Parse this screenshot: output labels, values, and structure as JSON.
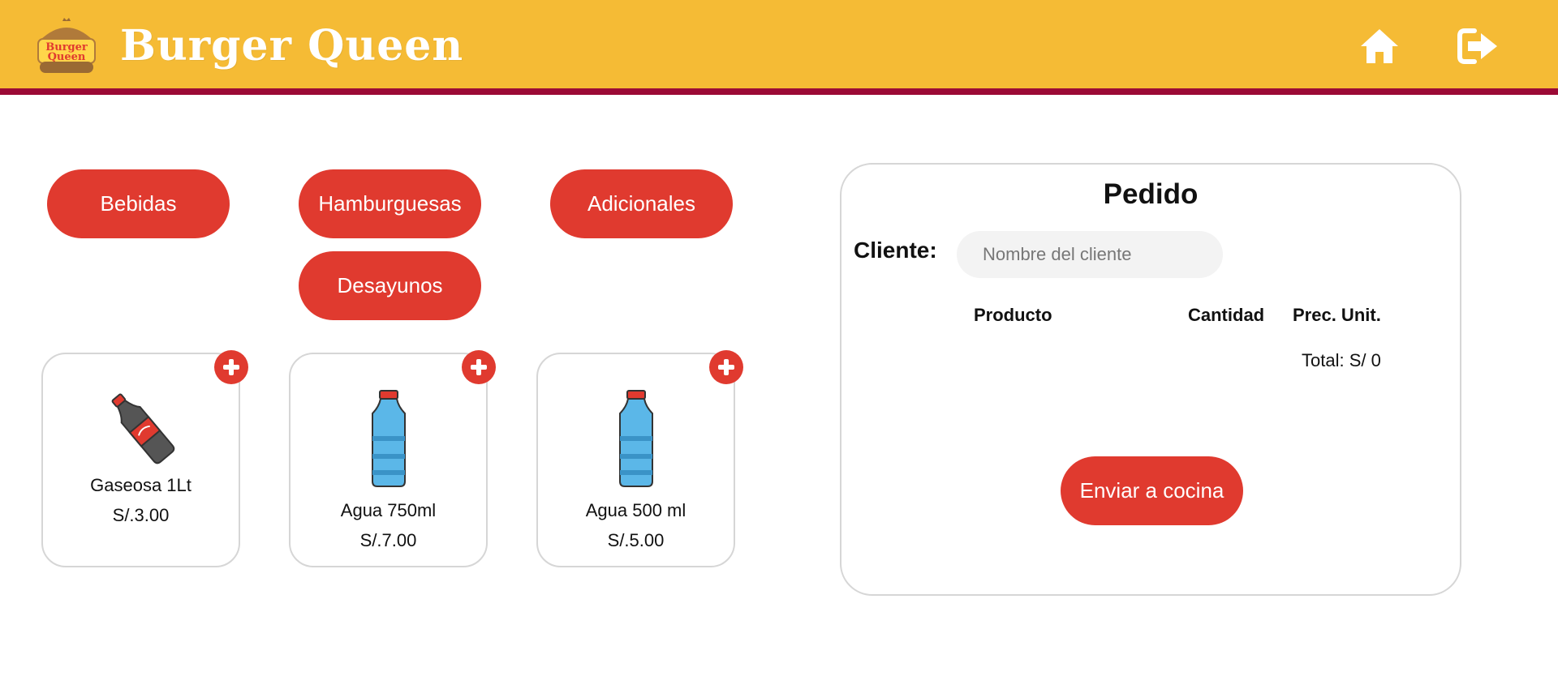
{
  "header": {
    "brand": "Burger Queen",
    "logo_text_line1": "Burger",
    "logo_text_line2": "Queen",
    "background": "#f5bb35",
    "border_color": "#9b0a36",
    "home_icon": "home-icon",
    "logout_icon": "logout-icon"
  },
  "categories": [
    {
      "label": "Bebidas"
    },
    {
      "label": "Hamburguesas"
    },
    {
      "label": "Adicionales"
    },
    {
      "label": "Desayunos"
    }
  ],
  "products": [
    {
      "name": "Gaseosa 1Lt",
      "price": "S/.3.00",
      "icon": "soda-bottle-icon"
    },
    {
      "name": "Agua 750ml",
      "price": "S/.7.00",
      "icon": "water-bottle-icon"
    },
    {
      "name": "Agua 500 ml",
      "price": "S/.5.00",
      "icon": "water-bottle-icon"
    }
  ],
  "order": {
    "title": "Pedido",
    "client_label": "Cliente:",
    "client_placeholder": "Nombre del cliente",
    "client_value": "",
    "columns": [
      "Producto",
      "Cantidad",
      "Prec. Unit."
    ],
    "total": "Total: S/ 0",
    "send_label": "Enviar a cocina"
  },
  "colors": {
    "accent": "#e03a2f",
    "header_bg": "#f5bb35",
    "header_border": "#9b0a36"
  }
}
